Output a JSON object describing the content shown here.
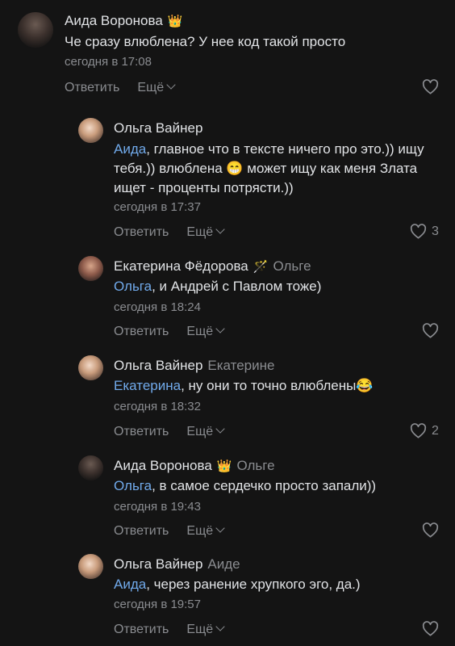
{
  "labels": {
    "reply": "Ответить",
    "more": "Ещё"
  },
  "comments": [
    {
      "author": "Аида Воронова",
      "badge": "👑",
      "reply_to": "",
      "mention": "",
      "text": "Че сразу влюблена? У нее код такой просто",
      "time": "сегодня в 17:08",
      "likes": ""
    },
    {
      "author": "Ольга Вайнер",
      "badge": "",
      "reply_to": "",
      "mention": "Аида",
      "text": ", главное что в тексте ничего про это.)) ищу тебя.)) влюблена 😁 может ищу как меня Злата ищет - проценты потрясти.))",
      "time": "сегодня в 17:37",
      "likes": "3"
    },
    {
      "author": "Екатерина Фёдорова",
      "badge": "🪄",
      "reply_to": "Ольге",
      "mention": "Ольга",
      "text": ", и Андрей с Павлом тоже)",
      "time": "сегодня в 18:24",
      "likes": ""
    },
    {
      "author": "Ольга Вайнер",
      "badge": "",
      "reply_to": "Екатерине",
      "mention": "Екатерина",
      "text": ", ну они то точно влюблены😂",
      "time": "сегодня в 18:32",
      "likes": "2"
    },
    {
      "author": "Аида Воронова",
      "badge": "👑",
      "reply_to": "Ольге",
      "mention": "Ольга",
      "text": ", в самое сердечко просто запали))",
      "time": "сегодня в 19:43",
      "likes": ""
    },
    {
      "author": "Ольга Вайнер",
      "badge": "",
      "reply_to": "Аиде",
      "mention": "Аида",
      "text": ", через ранение хрупкого эго, да.)",
      "time": "сегодня в 19:57",
      "likes": ""
    }
  ]
}
